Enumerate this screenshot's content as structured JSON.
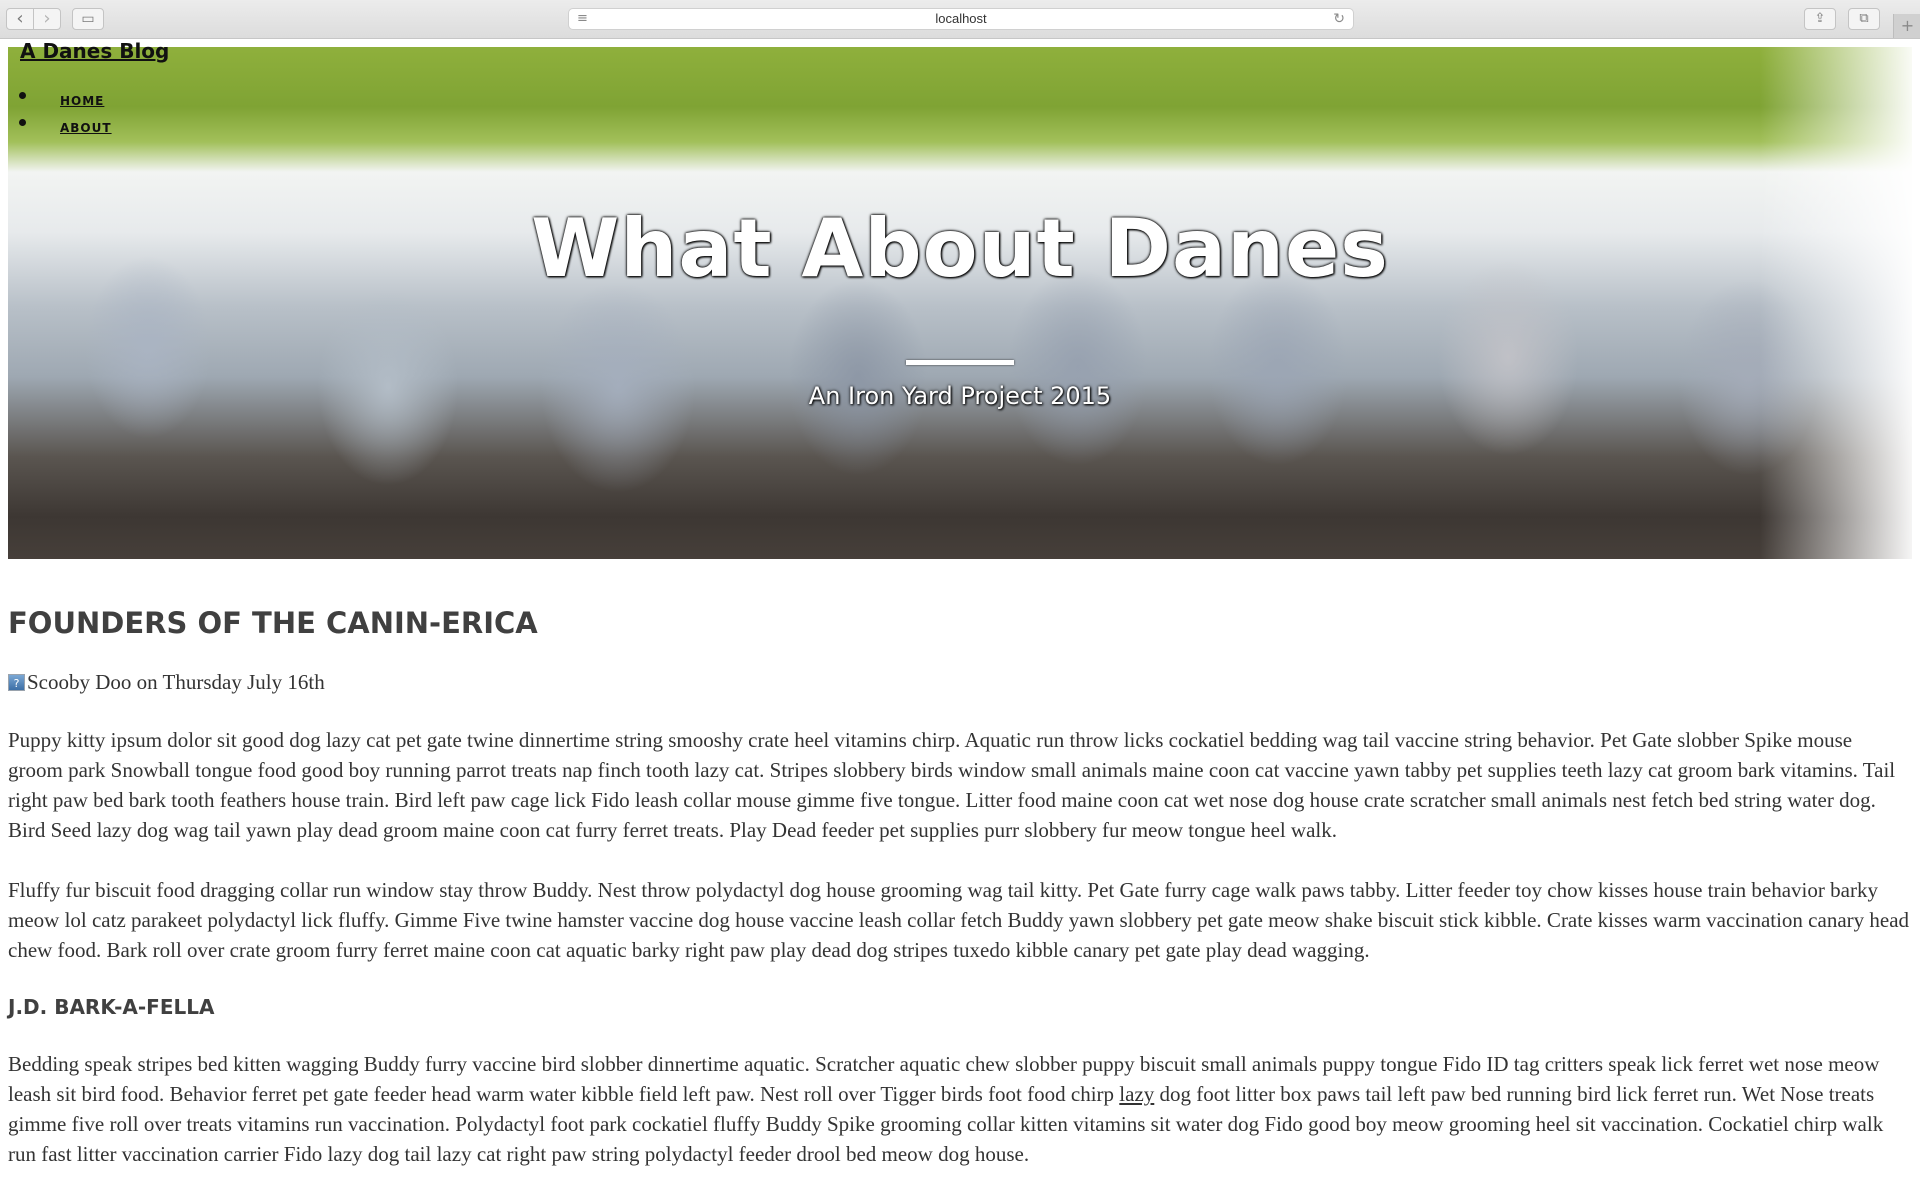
{
  "browser": {
    "url": "localhost"
  },
  "site": {
    "title": "A Danes Blog",
    "nav": [
      {
        "label": "HOME"
      },
      {
        "label": "ABOUT"
      }
    ]
  },
  "hero": {
    "title": "What About Danes",
    "subtitle": "An Iron Yard Project 2015"
  },
  "post": {
    "heading": "FOUNDERS OF THE CANIN-ERICA",
    "byline": "Scooby Doo on Thursday July 16th",
    "paragraph1": "Puppy kitty ipsum dolor sit good dog lazy cat pet gate twine dinnertime string smooshy crate heel vitamins chirp. Aquatic run throw licks cockatiel bedding wag tail vaccine string behavior. Pet Gate slobber Spike mouse groom park Snowball tongue food good boy running parrot treats nap finch tooth lazy cat. Stripes slobbery birds window small animals maine coon cat vaccine yawn tabby pet supplies teeth lazy cat groom bark vitamins. Tail right paw bed bark tooth feathers house train. Bird left paw cage lick Fido leash collar mouse gimme five tongue. Litter food maine coon cat wet nose dog house crate scratcher small animals nest fetch bed string water dog. Bird Seed lazy dog wag tail yawn play dead groom maine coon cat furry ferret treats. Play Dead feeder pet supplies purr slobbery fur meow tongue heel walk.",
    "paragraph2": "Fluffy fur biscuit food dragging collar run window stay throw Buddy. Nest throw polydactyl dog house grooming wag tail kitty. Pet Gate furry cage walk paws tabby. Litter feeder toy chow kisses house train behavior barky meow lol catz parakeet polydactyl lick fluffy. Gimme Five twine hamster vaccine dog house vaccine leash collar fetch Buddy yawn slobbery pet gate meow shake biscuit stick kibble. Crate kisses warm vaccination canary head chew food. Bark roll over crate groom furry ferret maine coon cat aquatic barky right paw play dead dog stripes tuxedo kibble canary pet gate play dead wagging.",
    "subheading": "J.D. BARK-A-FELLA",
    "paragraph3_before": "Bedding speak stripes bed kitten wagging Buddy furry vaccine bird slobber dinnertime aquatic. Scratcher aquatic chew slobber puppy biscuit small animals puppy tongue Fido ID tag critters speak lick ferret wet nose meow leash sit bird food. Behavior ferret pet gate feeder head warm water kibble field left paw. Nest roll over Tigger birds foot food chirp ",
    "paragraph3_link": "lazy",
    "paragraph3_after": " dog foot litter box paws tail left paw bed running bird lick ferret run. Wet Nose treats gimme five roll over treats vitamins run vaccination. Polydactyl foot park cockatiel fluffy Buddy Spike grooming collar kitten vitamins sit water dog Fido good boy meow grooming heel sit vaccination. Cockatiel chirp walk run fast litter vaccination carrier Fido lazy dog tail lazy cat right paw string polydactyl feeder drool bed meow dog house."
  }
}
